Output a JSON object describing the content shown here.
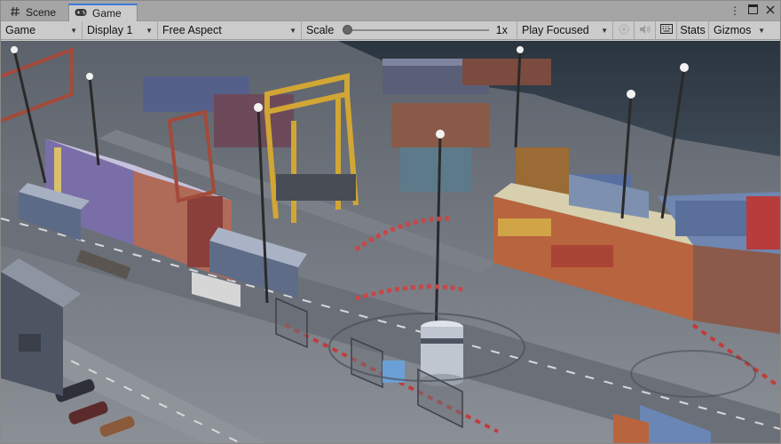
{
  "tabs": [
    {
      "label": "Scene",
      "icon": "hashtag-grid-icon"
    },
    {
      "label": "Game",
      "icon": "gamepad-icon"
    }
  ],
  "toolbar": {
    "display_mode": "Game",
    "display": "Display 1",
    "aspect": "Free Aspect",
    "scale_label": "Scale",
    "scale_value": "1x",
    "scale_fraction": 0.0,
    "play_mode": "Play Focused",
    "stats_label": "Stats",
    "gizmos_label": "Gizmos"
  },
  "colors": {
    "tab_accent": "#3a79d8",
    "toolbar_bg": "#cbcbcb",
    "tabbar_bg": "#a5a5a5"
  },
  "viewport": {
    "content": "3D container port scene"
  }
}
